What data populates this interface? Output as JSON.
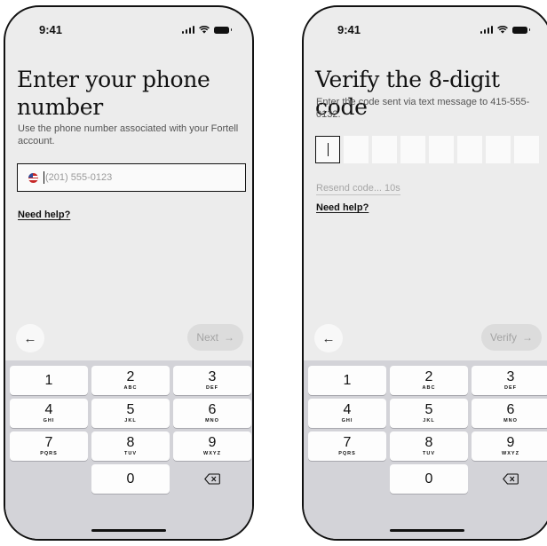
{
  "status_bar": {
    "time": "9:41"
  },
  "phone_screen": {
    "title": "Enter your phone number",
    "subtitle": "Use the phone number associated with your Fortell account.",
    "phone_field": {
      "placeholder": "(201) 555-0123",
      "value": ""
    },
    "help_link": "Need help?",
    "back_icon": "←",
    "next_button": {
      "label": "Next",
      "icon": "→"
    }
  },
  "verify_screen": {
    "title": "Verify the 8-digit code",
    "subtitle": "Enter the code sent via text message to 415-555-0132.",
    "code_length": 8,
    "resend_text": "Resend code... 10s",
    "help_link": "Need help?",
    "back_icon": "←",
    "verify_button": {
      "label": "Verify",
      "icon": "→"
    }
  },
  "keypad": {
    "keys": [
      {
        "digit": "1",
        "letters": ""
      },
      {
        "digit": "2",
        "letters": "ABC"
      },
      {
        "digit": "3",
        "letters": "DEF"
      },
      {
        "digit": "4",
        "letters": "GHI"
      },
      {
        "digit": "5",
        "letters": "JKL"
      },
      {
        "digit": "6",
        "letters": "MNO"
      },
      {
        "digit": "7",
        "letters": "PQRS"
      },
      {
        "digit": "8",
        "letters": "TUV"
      },
      {
        "digit": "9",
        "letters": "WXYZ"
      },
      {
        "digit": "0",
        "letters": ""
      }
    ]
  },
  "colors": {
    "screen_background": "#ececec",
    "keypad_background": "#d3d3d8",
    "disabled_button": "#dcdcdc",
    "text_primary": "#111111"
  },
  "icons": [
    "signal-icon",
    "wifi-icon",
    "battery-icon",
    "us-flag-icon",
    "arrow-left-icon",
    "arrow-right-icon",
    "backspace-icon"
  ]
}
